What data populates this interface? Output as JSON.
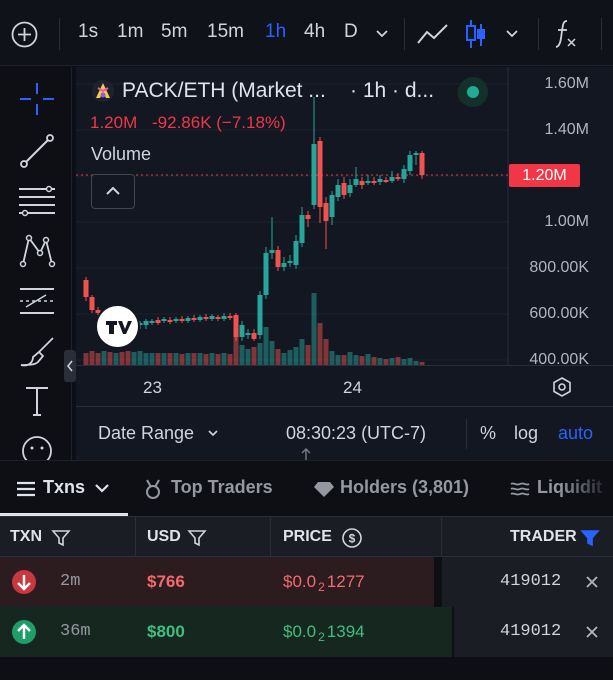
{
  "toolbar": {
    "intervals": [
      "1s",
      "1m",
      "5m",
      "15m",
      "1h",
      "4h",
      "D"
    ],
    "active_interval": "1h",
    "colors": {
      "active": "#2962ff"
    }
  },
  "chart": {
    "pair": "PACK/ETH (Market ...",
    "interval_suffix": "· 1h · d...",
    "price": "1.20M",
    "change": "-92.86K (−7.18%)",
    "volume_label": "Volume",
    "current_price_tag": "1.20M",
    "y_ticks": [
      "1.60M",
      "1.40M",
      "1.00M",
      "800.00K",
      "600.00K",
      "400.00K"
    ],
    "x_ticks": [
      "23",
      "24"
    ],
    "colors": {
      "up": "#26a69a",
      "down": "#ef5350",
      "price_tag": "#f23645"
    }
  },
  "chart_data": {
    "type": "candlestick",
    "x_ticks": [
      "23",
      "24"
    ],
    "ylim": [
      400000,
      1600000
    ],
    "last_price": 1200000
  },
  "bottom_bar": {
    "date_range": "Date Range",
    "time": "08:30:23 (UTC-7)",
    "percent": "%",
    "log": "log",
    "auto": "auto"
  },
  "tabs": {
    "txns": "Txns",
    "top_traders": "Top Traders",
    "holders": "Holders (3,801)",
    "liquidity": "Liquidit"
  },
  "table": {
    "headers": {
      "txn": "TXN",
      "usd": "USD",
      "price": "PRICE",
      "trader": "TRADER"
    },
    "rows": [
      {
        "type": "sell",
        "age": "2m",
        "usd": "$766",
        "price_prefix": "$0.0",
        "price_zeros": "2",
        "price_digits": "1277",
        "trader": "419012"
      },
      {
        "type": "buy",
        "age": "36m",
        "usd": "$800",
        "price_prefix": "$0.0",
        "price_zeros": "2",
        "price_digits": "1394",
        "trader": "419012"
      }
    ]
  }
}
